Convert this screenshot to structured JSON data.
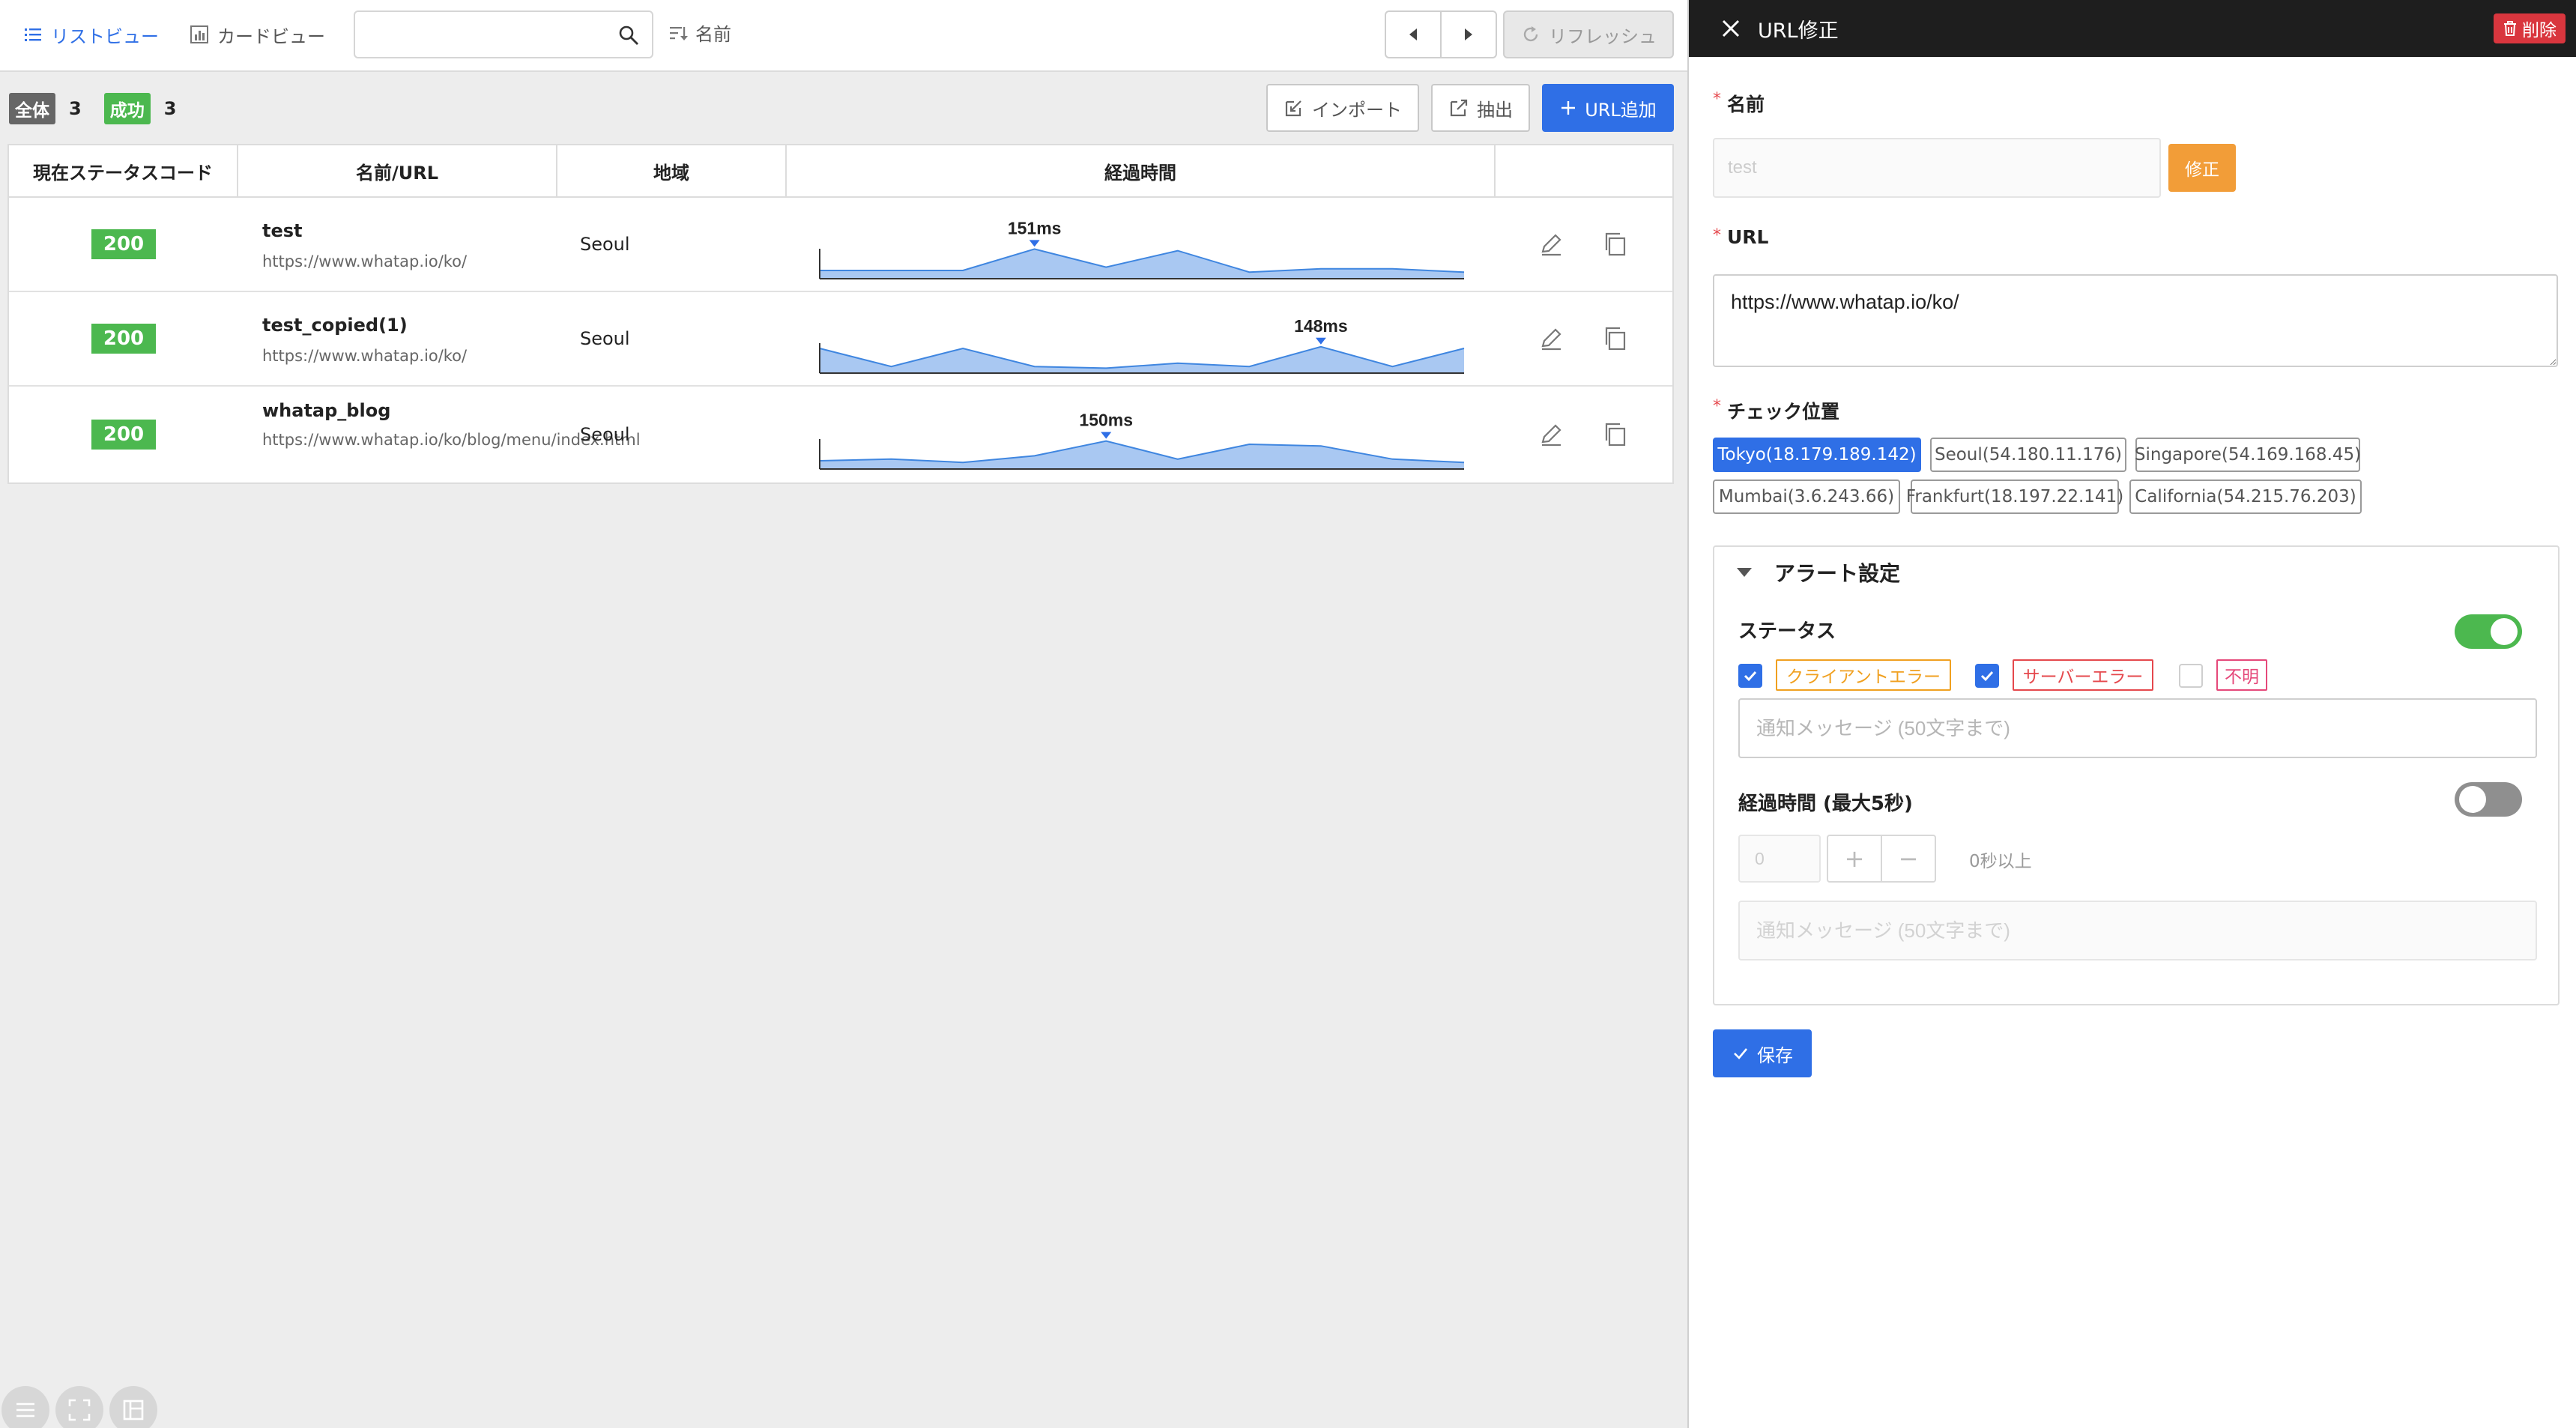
{
  "toolbar": {
    "list_view": "リストビュー",
    "card_view": "カードビュー",
    "search_placeholder": "",
    "sort_label": "名前",
    "refresh_label": "リフレッシュ"
  },
  "summary": {
    "all_label": "全体",
    "all_count": "3",
    "all_color": "#666666",
    "success_label": "成功",
    "success_count": "3",
    "success_color": "#4cb84f"
  },
  "actions": {
    "import": "インポート",
    "export": "抽出",
    "add_url": "URL追加"
  },
  "table": {
    "headers": [
      "現在ステータスコード",
      "名前/URL",
      "地域",
      "経過時間",
      ""
    ],
    "rows": [
      {
        "status": "200",
        "name": "test",
        "url": "https://www.whatap.io/ko/",
        "region": "Seoul",
        "latency_label": "151ms",
        "series": [
          5,
          5,
          5,
          18,
          7,
          17,
          4,
          6,
          6,
          4
        ]
      },
      {
        "status": "200",
        "name": "test_copied(1)",
        "url": "https://www.whatap.io/ko/",
        "region": "Seoul",
        "latency_label": "148ms",
        "series": [
          15,
          4,
          15,
          4,
          3,
          6,
          4,
          16,
          4,
          15
        ]
      },
      {
        "status": "200",
        "name": "whatap_blog",
        "url": "https://www.whatap.io/ko/blog/menu/index.html",
        "region": "Seoul",
        "latency_label": "150ms",
        "series": [
          5,
          6,
          4,
          8,
          17,
          6,
          15,
          14,
          6,
          4
        ]
      }
    ]
  },
  "panel": {
    "title": "URL修正",
    "delete_label": "削除",
    "name_label": "名前",
    "name_value": "test",
    "edit_label": "修正",
    "url_label": "URL",
    "url_value": "https://www.whatap.io/ko/",
    "location_label": "チェック位置",
    "locations": [
      {
        "label": "Tokyo(18.179.189.142)",
        "selected": true
      },
      {
        "label": "Seoul(54.180.11.176)",
        "selected": false
      },
      {
        "label": "Singapore(54.169.168.45)",
        "selected": false
      },
      {
        "label": "Mumbai(3.6.243.66)",
        "selected": false
      },
      {
        "label": "Frankfurt(18.197.22.141)",
        "selected": false
      },
      {
        "label": "California(54.215.76.203)",
        "selected": false
      }
    ],
    "alert": {
      "title": "アラート設定",
      "status_label": "ステータス",
      "status_enabled": true,
      "client_error": "クライアントエラー",
      "client_error_checked": true,
      "client_error_color": "#f0a020",
      "server_error": "サーバーエラー",
      "server_error_checked": true,
      "server_error_color": "#e5484d",
      "unknown": "不明",
      "unknown_checked": false,
      "unknown_color": "#e5487a",
      "status_msg_placeholder": "通知メッセージ (50文字まで)",
      "elapsed_label": "経過時間 (最大5秒)",
      "elapsed_enabled": false,
      "elapsed_value": "0",
      "elapsed_unit": "0秒以上",
      "elapsed_msg_placeholder": "通知メッセージ (50文字まで)"
    },
    "save_label": "保存"
  },
  "colors": {
    "accent": "#2f6fe6",
    "success": "#4cb84f",
    "danger": "#d9363e",
    "warning": "#f29d38"
  }
}
